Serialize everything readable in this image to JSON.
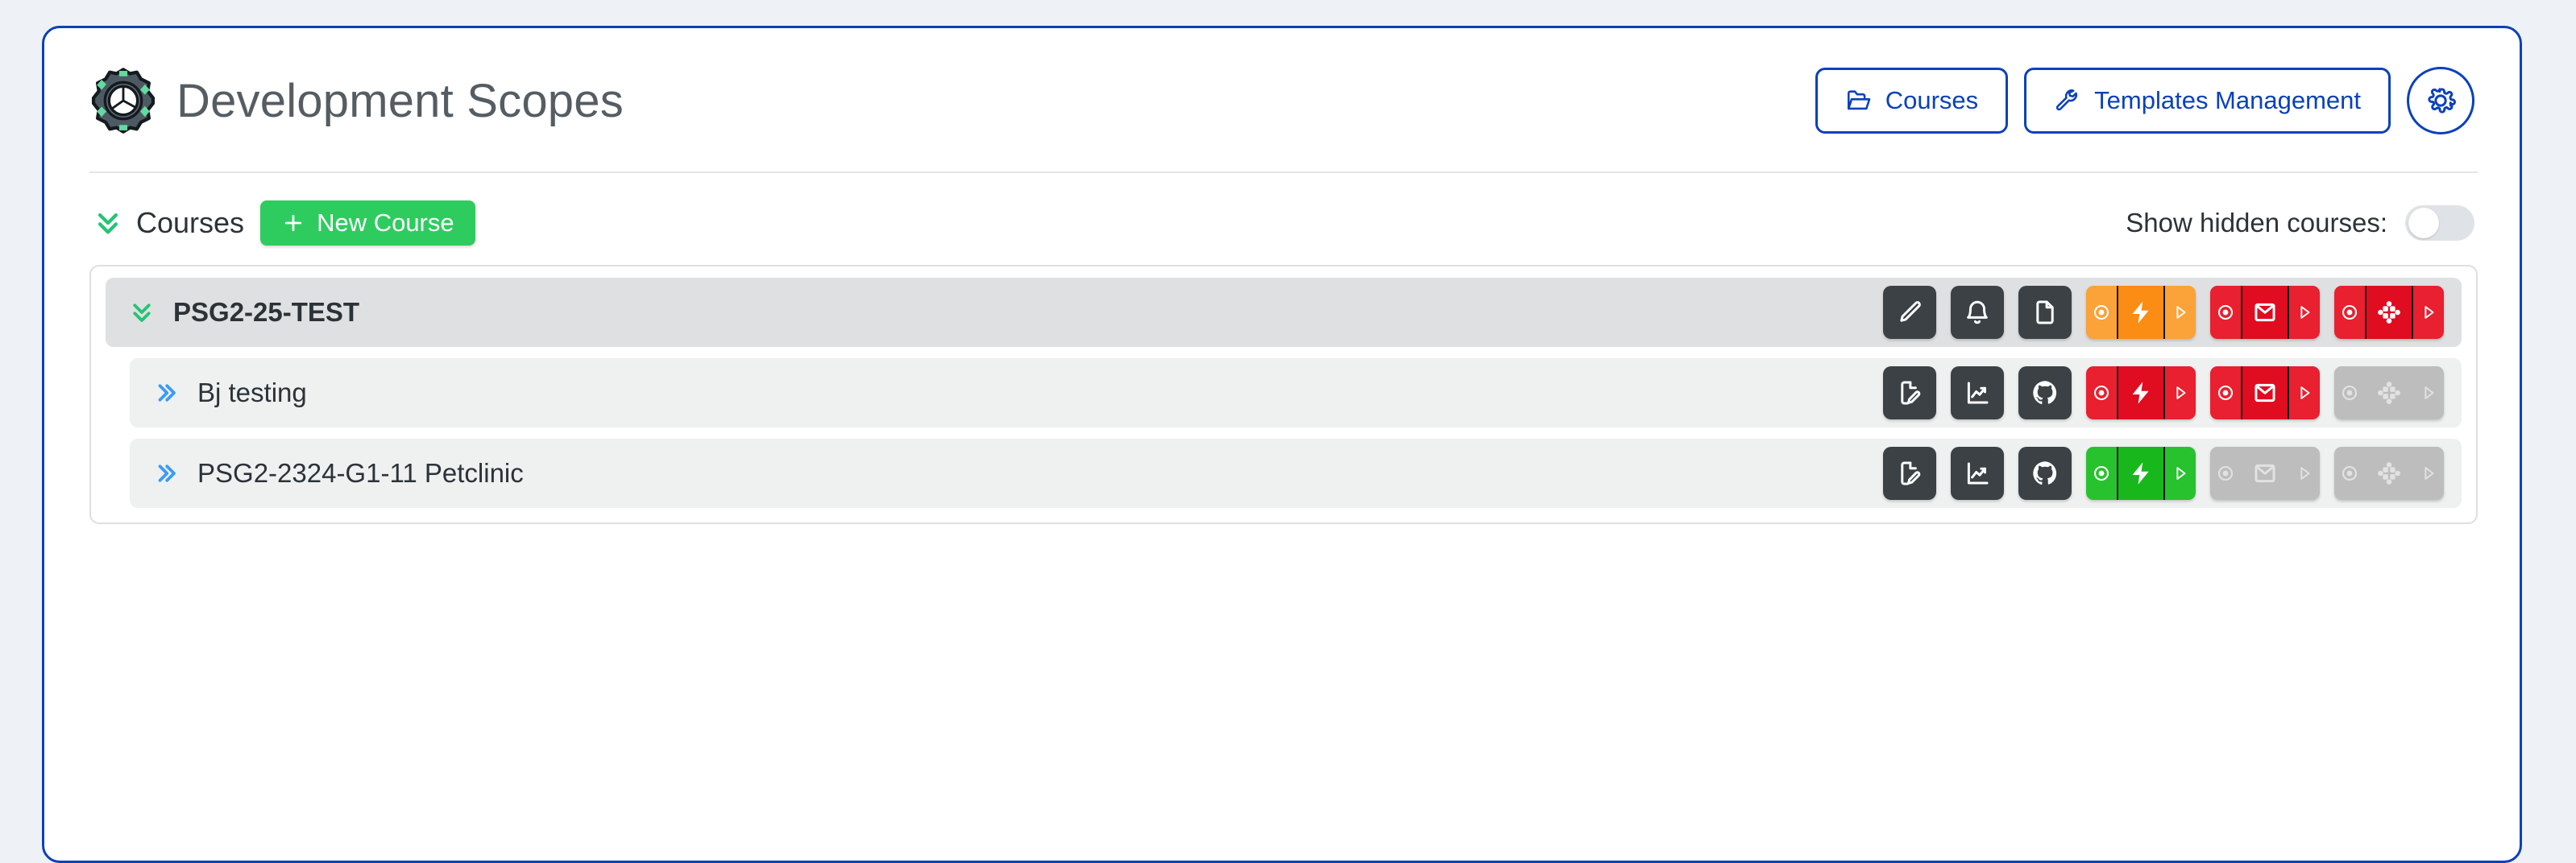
{
  "header": {
    "title": "Development Scopes",
    "logo_icon": "gear-logo-icon",
    "buttons": [
      {
        "label": "Courses",
        "icon": "folder-open-icon",
        "name": "courses-button"
      },
      {
        "label": "Templates  Management",
        "icon": "wrench-icon",
        "name": "templates-management-button"
      }
    ],
    "settings_icon": "gear-icon"
  },
  "toolbar": {
    "collapse_icon": "chevron-double-down-icon",
    "courses_label": "Courses",
    "new_course_label": "New Course",
    "new_course_icon": "plus-icon",
    "show_hidden_label": "Show hidden courses:",
    "show_hidden_state": "off"
  },
  "colors": {
    "accent_blue": "#0b41ba",
    "green": "#2ecc5f",
    "orange": "#fb8c14",
    "red": "#e00c1f",
    "status_green": "#18b81c",
    "gray_disabled": "#bdbdbd",
    "dark_button": "#3b4145"
  },
  "courses": [
    {
      "title": "PSG2-25-TEST",
      "level": "parent",
      "chevron_icon": "chevron-double-down-icon",
      "chevron_color": "#2ecc5f",
      "icon_buttons": [
        {
          "name": "edit-button",
          "icon": "pencil-icon"
        },
        {
          "name": "notifications-button",
          "icon": "bell-icon"
        },
        {
          "name": "document-button",
          "icon": "file-icon"
        }
      ],
      "status_groups": [
        {
          "name": "pipeline-group",
          "icon": "lightning-icon",
          "state": "orange",
          "left_icon": "record-icon",
          "right_icon": "play-icon"
        },
        {
          "name": "mail-group",
          "icon": "envelope-icon",
          "state": "red",
          "left_icon": "record-icon",
          "right_icon": "play-icon"
        },
        {
          "name": "slack-group",
          "icon": "slack-icon",
          "state": "red",
          "left_icon": "record-icon",
          "right_icon": "play-icon"
        }
      ]
    },
    {
      "title": "Bj testing",
      "level": "child",
      "chevron_icon": "chevron-double-right-icon",
      "chevron_color": "#3a9cf5",
      "icon_buttons": [
        {
          "name": "edit-document-button",
          "icon": "file-edit-icon"
        },
        {
          "name": "analytics-button",
          "icon": "chart-line-icon"
        },
        {
          "name": "github-button",
          "icon": "github-icon"
        }
      ],
      "status_groups": [
        {
          "name": "pipeline-group",
          "icon": "lightning-icon",
          "state": "red",
          "left_icon": "record-icon",
          "right_icon": "play-icon"
        },
        {
          "name": "mail-group",
          "icon": "envelope-icon",
          "state": "red",
          "left_icon": "record-icon",
          "right_icon": "play-icon"
        },
        {
          "name": "slack-group",
          "icon": "slack-icon",
          "state": "disabled",
          "left_icon": "record-icon",
          "right_icon": "play-icon"
        }
      ]
    },
    {
      "title": "PSG2-2324-G1-11  Petclinic",
      "level": "child",
      "chevron_icon": "chevron-double-right-icon",
      "chevron_color": "#3a9cf5",
      "icon_buttons": [
        {
          "name": "edit-document-button",
          "icon": "file-edit-icon"
        },
        {
          "name": "analytics-button",
          "icon": "chart-line-icon"
        },
        {
          "name": "github-button",
          "icon": "github-icon"
        }
      ],
      "status_groups": [
        {
          "name": "pipeline-group",
          "icon": "lightning-icon",
          "state": "green",
          "left_icon": "record-icon",
          "right_icon": "play-icon"
        },
        {
          "name": "mail-group",
          "icon": "envelope-icon",
          "state": "disabled",
          "left_icon": "record-icon",
          "right_icon": "play-icon"
        },
        {
          "name": "slack-group",
          "icon": "slack-icon",
          "state": "disabled",
          "left_icon": "record-icon",
          "right_icon": "play-icon"
        }
      ]
    }
  ]
}
